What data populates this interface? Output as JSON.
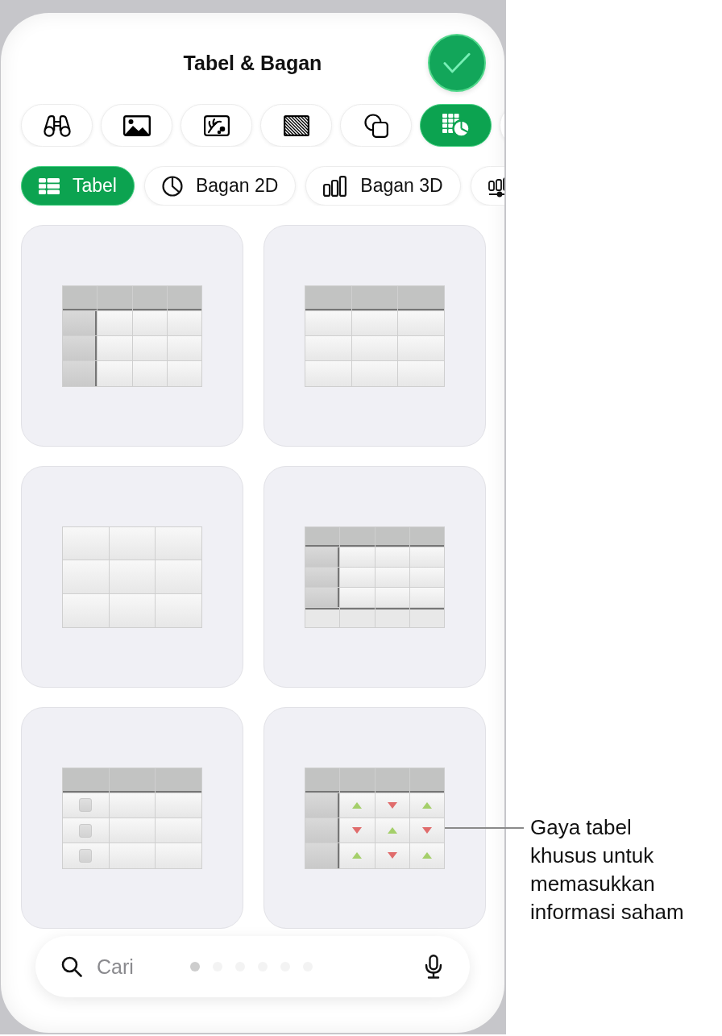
{
  "header": {
    "title": "Tabel & Bagan"
  },
  "categories": [
    {
      "kind": "binoculars",
      "selected": false
    },
    {
      "kind": "photo",
      "selected": false
    },
    {
      "kind": "plant",
      "selected": false
    },
    {
      "kind": "hatch",
      "selected": false
    },
    {
      "kind": "shapes",
      "selected": false
    },
    {
      "kind": "tablechart",
      "selected": true
    },
    {
      "selected": false
    }
  ],
  "chart_types": [
    {
      "kind": "table",
      "label": "Tabel",
      "selected": true
    },
    {
      "kind": "pie",
      "label": "Bagan 2D",
      "selected": false
    },
    {
      "kind": "bars",
      "label": "Bagan 3D",
      "selected": false
    },
    {
      "kind": "slider",
      "selected": false
    }
  ],
  "table_styles": [
    {
      "header_row": true,
      "header_column": true,
      "footer_row": false,
      "checkbox_column": false
    },
    {
      "header_row": true,
      "header_column": false,
      "footer_row": false,
      "checkbox_column": false
    },
    {
      "header_row": false,
      "header_column": false,
      "footer_row": false,
      "checkbox_column": false
    },
    {
      "header_row": true,
      "header_column": true,
      "footer_row": true,
      "checkbox_column": false
    },
    {
      "header_row": true,
      "header_column": false,
      "footer_row": false,
      "checkbox_column": true
    },
    {
      "header_row": true,
      "header_column": true,
      "footer_row": false,
      "checkbox_column": false,
      "stock_cells": [
        [
          {
            "rising": true
          },
          {
            "rising": false
          },
          {
            "rising": true
          }
        ],
        [
          {
            "rising": false
          },
          {
            "rising": true
          },
          {
            "rising": false
          }
        ],
        [
          {
            "rising": true
          },
          {
            "rising": false
          },
          {
            "rising": true
          }
        ]
      ]
    }
  ],
  "search": {
    "placeholder": "Cari"
  },
  "page_dots": [
    {
      "selected": true
    },
    {
      "selected": false
    },
    {
      "selected": false
    },
    {
      "selected": false
    },
    {
      "selected": false
    },
    {
      "selected": false
    }
  ],
  "callout": {
    "text": "Gaya tabel khusus untuk memasukkan informasi saham"
  }
}
